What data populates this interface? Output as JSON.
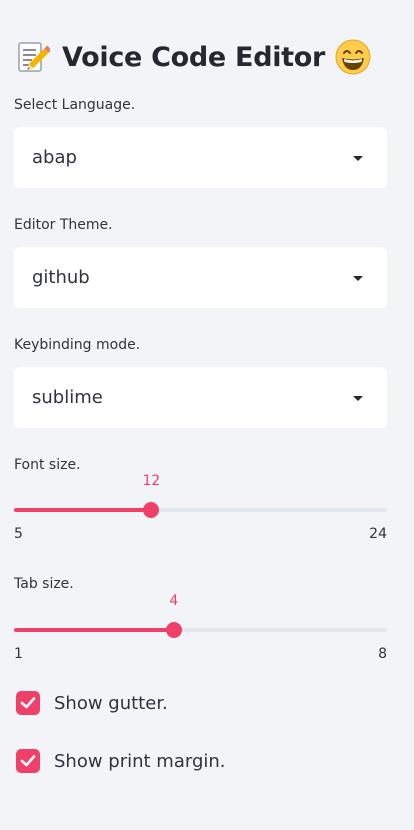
{
  "header": {
    "title": "Voice Code Editor",
    "leading_icon": "memo-icon",
    "trailing_icon": "grinning-face-icon"
  },
  "language": {
    "label": "Select Language.",
    "value": "abap"
  },
  "theme": {
    "label": "Editor Theme.",
    "value": "github"
  },
  "keybinding": {
    "label": "Keybinding mode.",
    "value": "sublime"
  },
  "font_size": {
    "label": "Font size.",
    "value": "12",
    "min": "5",
    "max": "24"
  },
  "tab_size": {
    "label": "Tab size.",
    "value": "4",
    "min": "1",
    "max": "8"
  },
  "options": {
    "gutter": {
      "label": "Show gutter.",
      "checked": true
    },
    "print_margin": {
      "label": "Show print margin.",
      "checked": true
    }
  },
  "colors": {
    "accent": "#f0406a",
    "background": "#f3f4f7",
    "input_background": "#ffffff",
    "text": "#31333f"
  }
}
